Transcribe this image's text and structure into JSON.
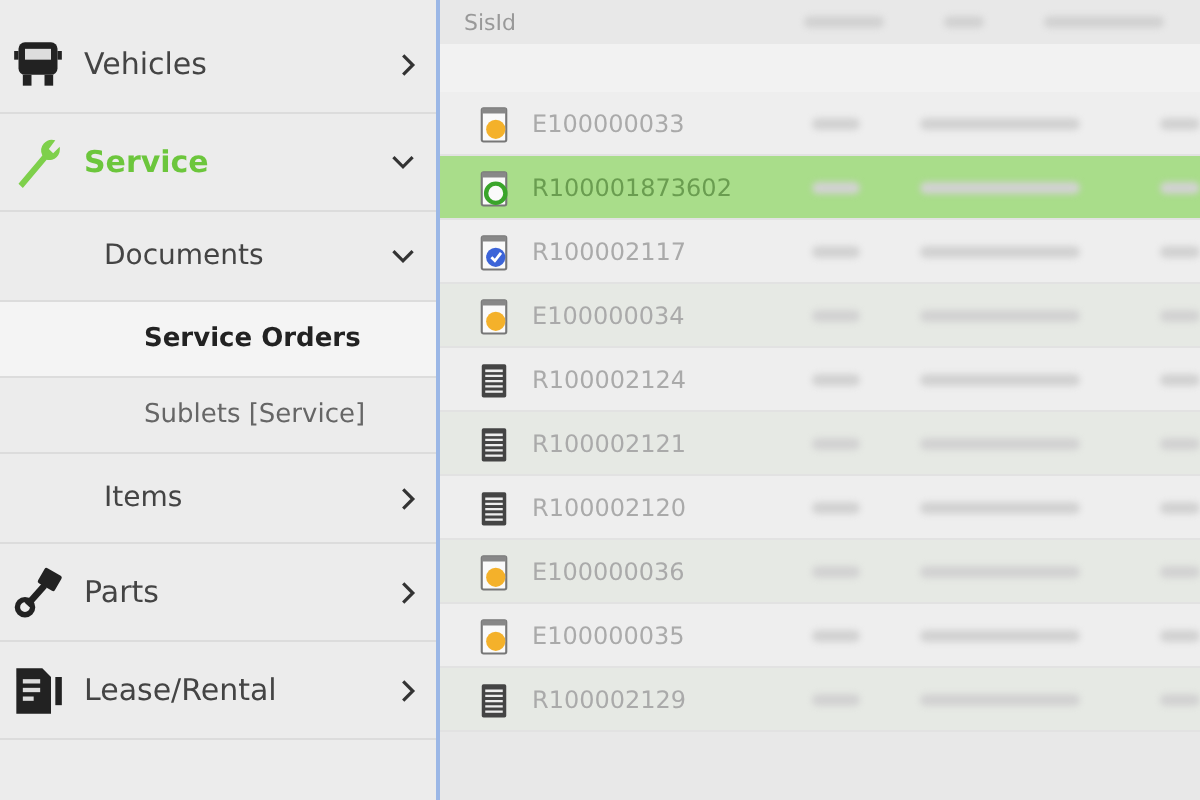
{
  "sidebar": {
    "items": [
      {
        "label": "Vehicles",
        "expanded": false,
        "selected": false
      },
      {
        "label": "Service",
        "expanded": true,
        "selected": true,
        "children": [
          {
            "label": "Documents",
            "expanded": true,
            "children": [
              {
                "label": "Service Orders",
                "selected": true
              },
              {
                "label": "Sublets [Service]",
                "selected": false
              }
            ]
          },
          {
            "label": "Items",
            "expanded": false
          }
        ]
      },
      {
        "label": "Parts",
        "expanded": false,
        "selected": false
      },
      {
        "label": "Lease/Rental",
        "expanded": false,
        "selected": false
      }
    ]
  },
  "table": {
    "columns": [
      {
        "label": "SisId"
      }
    ],
    "rows": [
      {
        "id": "E100000033",
        "kind": "pending",
        "selected": false
      },
      {
        "id": "R100001873602",
        "kind": "active",
        "selected": true
      },
      {
        "id": "R100002117",
        "kind": "done",
        "selected": false
      },
      {
        "id": "E100000034",
        "kind": "pending",
        "selected": false
      },
      {
        "id": "R100002124",
        "kind": "document",
        "selected": false
      },
      {
        "id": "R100002121",
        "kind": "document",
        "selected": false
      },
      {
        "id": "R100002120",
        "kind": "document",
        "selected": false
      },
      {
        "id": "E100000036",
        "kind": "pending",
        "selected": false
      },
      {
        "id": "E100000035",
        "kind": "pending",
        "selected": false
      },
      {
        "id": "R100002129",
        "kind": "document",
        "selected": false
      }
    ]
  }
}
